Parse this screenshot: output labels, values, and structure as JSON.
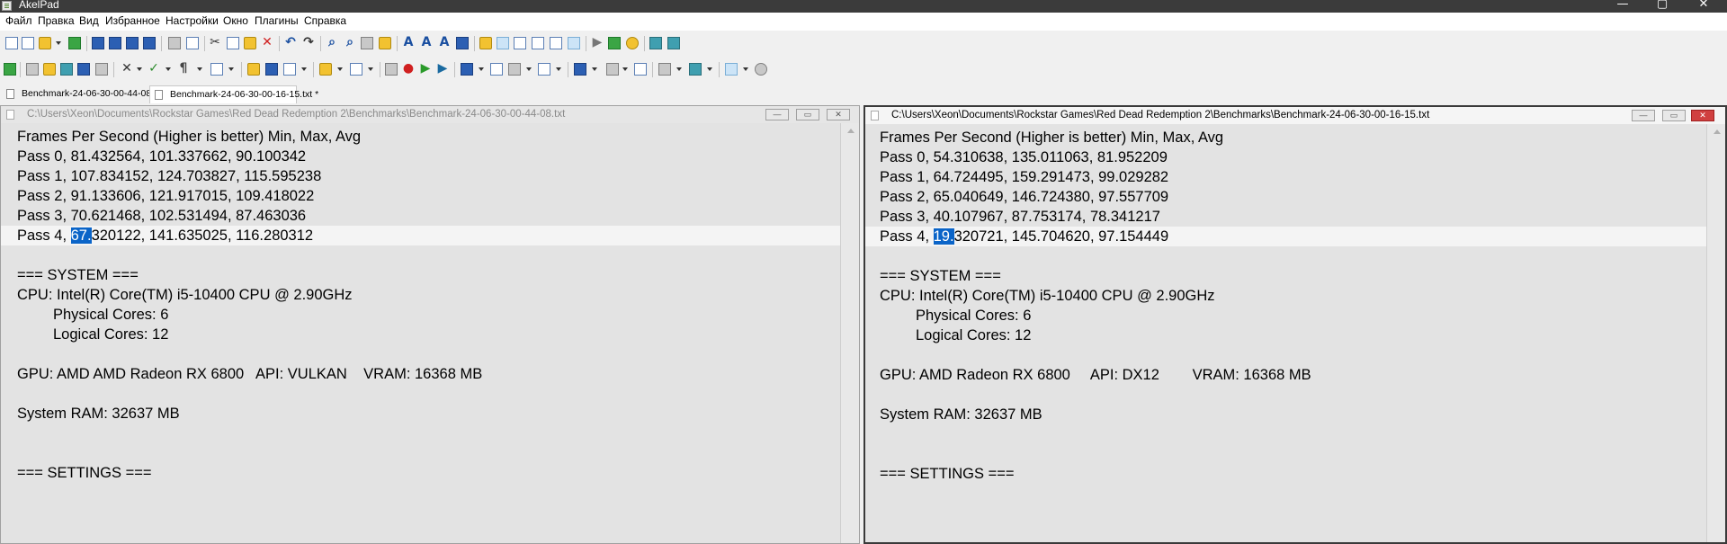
{
  "app": {
    "title": "AkelPad",
    "window_buttons": [
      "—",
      "▢",
      "✕"
    ]
  },
  "menu": [
    "Файл",
    "Правка",
    "Вид",
    "Избранное",
    "Настройки",
    "Окно",
    "Плагины",
    "Справка"
  ],
  "tabs": [
    {
      "label": "Benchmark-24-06-30-00-44-08.txt"
    },
    {
      "label": "Benchmark-24-06-30-00-16-15.txt *"
    }
  ],
  "panes": [
    {
      "path": "C:\\Users\\Xeon\\Documents\\Rockstar Games\\Red Dead Redemption 2\\Benchmarks\\Benchmark-24-06-30-00-44-08.txt",
      "lines": {
        "l0": "Frames Per Second (Higher is better) Min, Max, Avg",
        "l1": "Pass 0, 81.432564, 101.337662, 90.100342",
        "l2": "Pass 1, 107.834152, 124.703827, 115.595238",
        "l3": "Pass 2, 91.133606, 121.917015, 109.418022",
        "l4": "Pass 3, 70.621468, 102.531494, 87.463036",
        "l5_pre": "Pass 4, ",
        "l5_sel": "67.",
        "l5_post": "320122, 141.635025, 116.280312",
        "l7": "=== SYSTEM ===",
        "l8": "CPU: Intel(R) Core(TM) i5-10400 CPU @ 2.90GHz",
        "l9": "Physical Cores: 6",
        "l10": "Logical Cores: 12",
        "l12": "GPU: AMD AMD Radeon RX 6800   API: VULKAN    VRAM: 16368 MB",
        "l14": "System RAM: 32637 MB",
        "l17": "=== SETTINGS ==="
      }
    },
    {
      "path": "C:\\Users\\Xeon\\Documents\\Rockstar Games\\Red Dead Redemption 2\\Benchmarks\\Benchmark-24-06-30-00-16-15.txt",
      "lines": {
        "l0": "Frames Per Second (Higher is better) Min, Max, Avg",
        "l1": "Pass 0, 54.310638, 135.011063, 81.952209",
        "l2": "Pass 1, 64.724495, 159.291473, 99.029282",
        "l3": "Pass 2, 65.040649, 146.724380, 97.557709",
        "l4": "Pass 3, 40.107967, 87.753174, 78.341217",
        "l5_pre": "Pass 4, ",
        "l5_sel": "19.",
        "l5_post": "320721, 145.704620, 97.154449",
        "l7": "=== SYSTEM ===",
        "l8": "CPU: Intel(R) Core(TM) i5-10400 CPU @ 2.90GHz",
        "l9": "Physical Cores: 6",
        "l10": "Logical Cores: 12",
        "l12": "GPU: AMD Radeon RX 6800     API: DX12        VRAM: 16368 MB",
        "l14": "System RAM: 32637 MB",
        "l17": "=== SETTINGS ==="
      }
    }
  ],
  "colors": {
    "selection": "#0a64c8",
    "editor_bg": "#e3e3e3",
    "titlebar_bg": "#3b3b3b"
  }
}
